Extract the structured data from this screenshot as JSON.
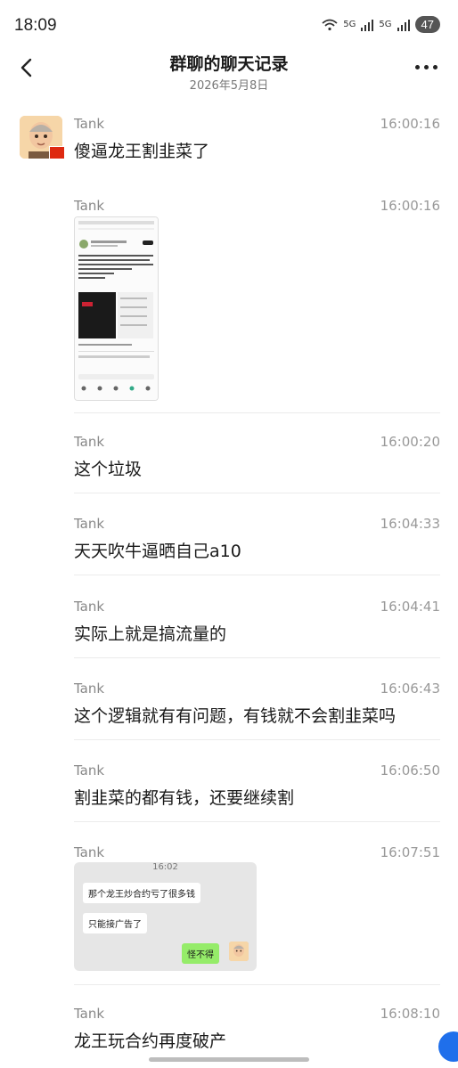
{
  "status": {
    "time": "18:09",
    "net1": "5G",
    "net2": "5G",
    "battery": "47"
  },
  "header": {
    "title": "群聊的聊天记录",
    "date": "2026年5月8日"
  },
  "messages": [
    {
      "sender": "Tank",
      "time": "16:00:16",
      "text": "傻逼龙王割韭菜了"
    },
    {
      "sender": "Tank",
      "time": "16:00:16",
      "text": ""
    },
    {
      "sender": "Tank",
      "time": "16:00:20",
      "text": "这个垃圾"
    },
    {
      "sender": "Tank",
      "time": "16:04:33",
      "text": "天天吹牛逼晒自己a10"
    },
    {
      "sender": "Tank",
      "time": "16:04:41",
      "text": "实际上就是搞流量的"
    },
    {
      "sender": "Tank",
      "time": "16:06:43",
      "text": "这个逻辑就有有问题，有钱就不会割韭菜吗"
    },
    {
      "sender": "Tank",
      "time": "16:06:50",
      "text": "割韭菜的都有钱，还要继续割"
    },
    {
      "sender": "Tank",
      "time": "16:07:51",
      "text": ""
    },
    {
      "sender": "Tank",
      "time": "16:08:10",
      "text": "龙王玩合约再度破产"
    }
  ],
  "embedded_chat": {
    "time": "16:02",
    "line1": "那个龙王炒合约亏了很多钱",
    "line2": "只能接广告了",
    "reply": "怪不得"
  },
  "colors": {
    "accent": "#1f6feb",
    "reply_bubble": "#95ec69"
  },
  "icons": [
    "back-arrow-icon",
    "more-dots-icon",
    "wifi-icon",
    "signal-icon",
    "battery-icon",
    "flag-icon"
  ]
}
